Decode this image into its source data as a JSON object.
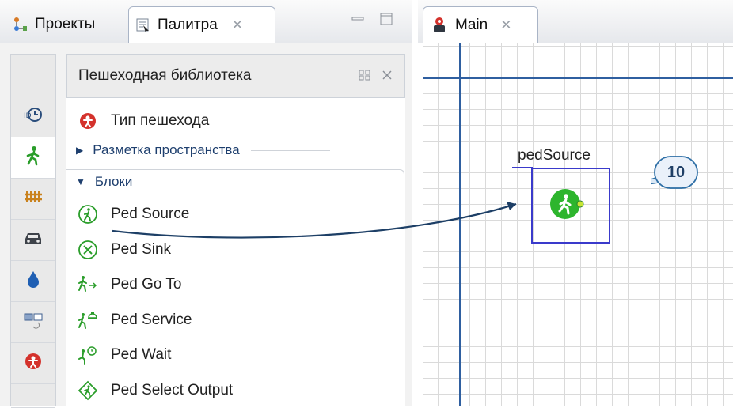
{
  "left_tabs": {
    "projects": {
      "label": "Проекты",
      "icon": "projects-icon"
    },
    "palette": {
      "label": "Палитра",
      "icon": "palette-icon",
      "close": "✕"
    }
  },
  "palette": {
    "title": "Пешеходная библиотека",
    "header_controls": [
      "view-mode-icon",
      "close-icon"
    ],
    "top_item": {
      "label": "Тип пешехода",
      "icon": "pedestrian-type-icon"
    },
    "sections": {
      "space": {
        "label": "Разметка пространства",
        "expanded": false
      },
      "blocks": {
        "label": "Блоки",
        "expanded": true
      }
    },
    "blocks": [
      {
        "label": "Ped Source",
        "icon": "ped-source-icon"
      },
      {
        "label": "Ped Sink",
        "icon": "ped-sink-icon"
      },
      {
        "label": "Ped Go To",
        "icon": "ped-goto-icon"
      },
      {
        "label": "Ped Service",
        "icon": "ped-service-icon"
      },
      {
        "label": "Ped Wait",
        "icon": "ped-wait-icon"
      },
      {
        "label": "Ped Select Output",
        "icon": "ped-select-output-icon"
      }
    ]
  },
  "vertical_bar": [
    "timeline-icon",
    "pedestrian-icon",
    "rail-icon",
    "car-icon",
    "fluid-icon",
    "agents-icon",
    "person-icon"
  ],
  "main_tab": {
    "label": "Main",
    "icon": "agent-icon",
    "close": "✕"
  },
  "canvas": {
    "block_name": "pedSource",
    "callout_number": "10"
  },
  "colors": {
    "accent_green": "#2db52d",
    "selection_blue": "#3a3acb",
    "arrow": "#1d3f66",
    "callout_border": "#2e6fa6"
  }
}
